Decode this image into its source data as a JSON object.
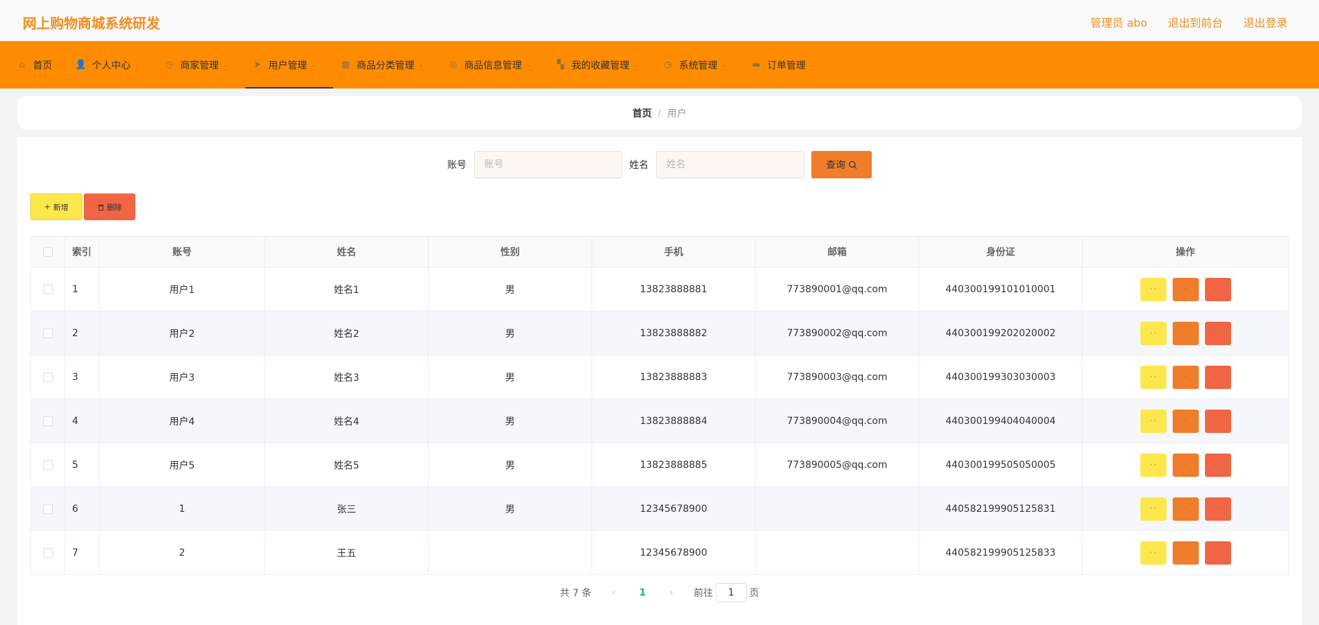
{
  "header": {
    "title": "网上购物商城系统研发",
    "links": [
      "管理员 abo",
      "退出到前台",
      "退出登录"
    ]
  },
  "nav": {
    "items": [
      {
        "label": "首页",
        "icon": "home-icon",
        "glyph": "⌂",
        "caret": false
      },
      {
        "label": "个人中心",
        "icon": "user-icon",
        "glyph": "👤",
        "caret": true
      },
      {
        "label": "商家管理",
        "icon": "compass-icon",
        "glyph": "◷",
        "caret": true
      },
      {
        "label": "用户管理",
        "icon": "send-icon",
        "glyph": "➤",
        "caret": true,
        "active": true
      },
      {
        "label": "商品分类管理",
        "icon": "calendar-icon",
        "glyph": "▦",
        "caret": true
      },
      {
        "label": "商品信息管理",
        "icon": "settings-icon",
        "glyph": "◎",
        "caret": true
      },
      {
        "label": "我的收藏管理",
        "icon": "grid-icon",
        "glyph": "▚",
        "caret": true
      },
      {
        "label": "系统管理",
        "icon": "compass-icon",
        "glyph": "◷",
        "caret": true
      },
      {
        "label": "订单管理",
        "icon": "monitor-icon",
        "glyph": "▬",
        "caret": true
      }
    ]
  },
  "breadcrumb": {
    "home": "首页",
    "separator": "/",
    "current": "用户"
  },
  "search": {
    "account_label": "账号",
    "account_placeholder": "账号",
    "name_label": "姓名",
    "name_placeholder": "姓名",
    "button_label": "查询"
  },
  "actions": {
    "add_label": "新增",
    "delete_label": "删除"
  },
  "table": {
    "headers": [
      "索引",
      "账号",
      "姓名",
      "性别",
      "手机",
      "邮箱",
      "身份证",
      "操作"
    ],
    "rows": [
      {
        "index": "1",
        "account": "用户1",
        "name": "姓名1",
        "gender": "男",
        "phone": "13823888881",
        "email": "773890001@qq.com",
        "id_card": "440300199101010001"
      },
      {
        "index": "2",
        "account": "用户2",
        "name": "姓名2",
        "gender": "男",
        "phone": "13823888882",
        "email": "773890002@qq.com",
        "id_card": "440300199202020002"
      },
      {
        "index": "3",
        "account": "用户3",
        "name": "姓名3",
        "gender": "男",
        "phone": "13823888883",
        "email": "773890003@qq.com",
        "id_card": "440300199303030003"
      },
      {
        "index": "4",
        "account": "用户4",
        "name": "姓名4",
        "gender": "男",
        "phone": "13823888884",
        "email": "773890004@qq.com",
        "id_card": "440300199404040004"
      },
      {
        "index": "5",
        "account": "用户5",
        "name": "姓名5",
        "gender": "男",
        "phone": "13823888885",
        "email": "773890005@qq.com",
        "id_card": "440300199505050005"
      },
      {
        "index": "6",
        "account": "1",
        "name": "张三",
        "gender": "男",
        "phone": "12345678900",
        "email": "",
        "id_card": "440582199905125831"
      },
      {
        "index": "7",
        "account": "2",
        "name": "王五",
        "gender": "",
        "phone": "12345678900",
        "email": "",
        "id_card": "440582199905125833"
      }
    ],
    "op_labels": {
      "view": "· ·",
      "edit": "·",
      "delete": "· ·"
    }
  },
  "pagination": {
    "total": "共 7 条",
    "prev": "‹",
    "current": "1",
    "next": "›",
    "goto_label": "前往",
    "goto_value": "1",
    "page_suffix": "页"
  },
  "colors": {
    "accent": "#ff8c00",
    "title": "#f38d1f",
    "view": "#fde74c",
    "edit": "#f07d2c",
    "delete": "#f06543"
  }
}
